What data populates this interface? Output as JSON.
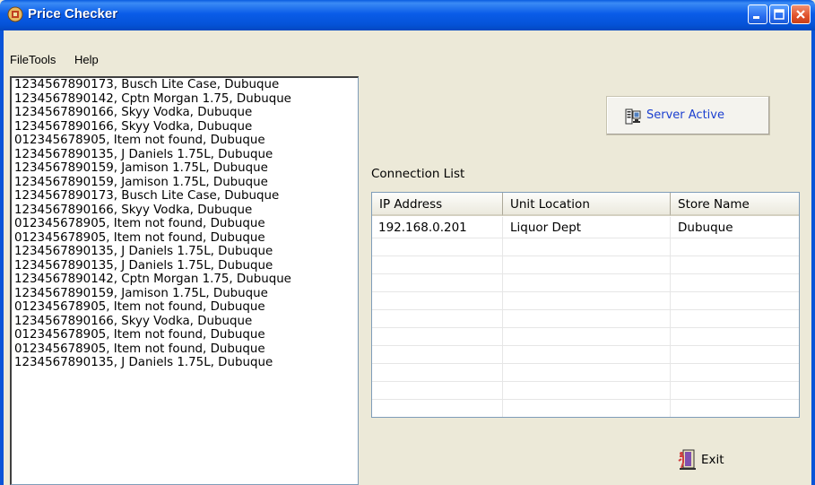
{
  "window": {
    "title": "Price Checker"
  },
  "menu": [
    {
      "label": "File"
    },
    {
      "label": "Tools"
    },
    {
      "label": "Help"
    }
  ],
  "log": [
    "1234567890173, Busch Lite Case, Dubuque",
    "1234567890142, Cptn Morgan 1.75, Dubuque",
    "1234567890166, Skyy Vodka, Dubuque",
    "1234567890166, Skyy Vodka, Dubuque",
    "012345678905, Item not found, Dubuque",
    "1234567890135, J Daniels 1.75L, Dubuque",
    "1234567890159, Jamison 1.75L, Dubuque",
    "1234567890159, Jamison 1.75L, Dubuque",
    "1234567890173, Busch Lite Case, Dubuque",
    "1234567890166, Skyy Vodka, Dubuque",
    "012345678905, Item not found, Dubuque",
    "012345678905, Item not found, Dubuque",
    "1234567890135, J Daniels 1.75L, Dubuque",
    "1234567890135, J Daniels 1.75L, Dubuque",
    "1234567890142, Cptn Morgan 1.75, Dubuque",
    "1234567890159, Jamison 1.75L, Dubuque",
    "012345678905, Item not found, Dubuque",
    "1234567890166, Skyy Vodka, Dubuque",
    "012345678905, Item not found, Dubuque",
    "012345678905, Item not found, Dubuque",
    "1234567890135, J Daniels 1.75L, Dubuque"
  ],
  "server": {
    "status_label": "Server Active",
    "icon": "server-icon"
  },
  "connections": {
    "label": "Connection List",
    "columns": [
      "IP Address",
      "Unit Location",
      "Store Name"
    ],
    "rows": [
      [
        "192.168.0.201",
        "Liquor Dept",
        "Dubuque"
      ]
    ]
  },
  "exit": {
    "label": "Exit",
    "icon": "exit-door-icon"
  },
  "colors": {
    "titlebar": "#0a5ce8",
    "server_text": "#1b3fd0",
    "close_button": "#e0502a"
  }
}
